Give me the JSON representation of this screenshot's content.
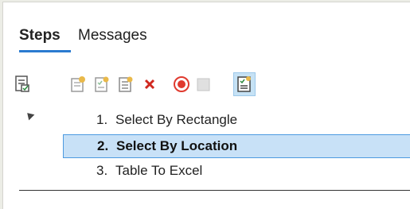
{
  "tabs": {
    "steps_label": "Steps",
    "messages_label": "Messages"
  },
  "toolbar": {
    "icons": [
      "properties-icon",
      "new-step-icon",
      "edit-step-icon",
      "copy-step-icon",
      "delete-icon",
      "record-icon",
      "stop-icon",
      "refresh-steps-icon"
    ],
    "delete_color": "#d0281f",
    "record_color": "#e03a2f"
  },
  "steps": [
    {
      "num": "1.",
      "label": "Select By Rectangle",
      "selected": false
    },
    {
      "num": "2.",
      "label": "Select By Location",
      "selected": true
    },
    {
      "num": "3.",
      "label": "Table To Excel",
      "selected": false
    }
  ],
  "colors": {
    "accent": "#2a7bd0",
    "selection_bg": "#c8e1f7",
    "selection_border": "#4c9ae0"
  }
}
